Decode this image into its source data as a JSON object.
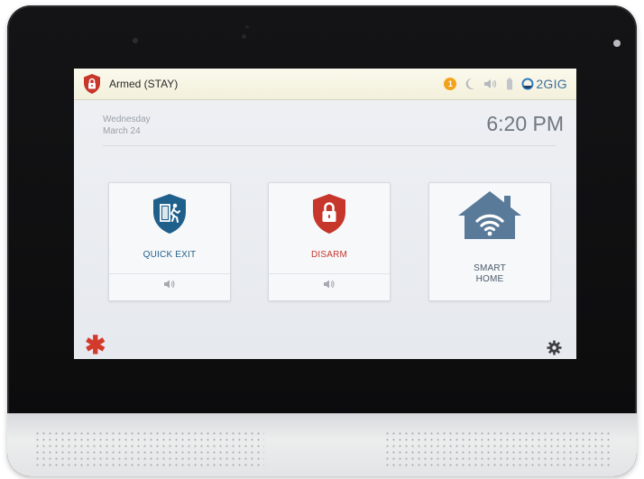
{
  "status_bar": {
    "arm_status": "Armed (STAY)",
    "alert_count": "1",
    "brand": "2GIG"
  },
  "datetime": {
    "weekday": "Wednesday",
    "date": "March 24",
    "time": "6:20 PM"
  },
  "tiles": [
    {
      "label": "QUICK EXIT",
      "icon": "quick-exit-shield-icon",
      "color": "#1f5f8b"
    },
    {
      "label": "DISARM",
      "icon": "lock-shield-icon",
      "color": "#c6362a"
    },
    {
      "label_line1": "SMART",
      "label_line2": "HOME",
      "icon": "smart-home-icon",
      "color": "#5a7a99"
    }
  ],
  "colors": {
    "armed_red": "#c6362a",
    "quick_exit_blue": "#1f5f8b",
    "smart_home_slate": "#5a7a99",
    "alert_orange": "#f3a31b",
    "asterisk_red": "#d33a2c"
  },
  "icons": {
    "status": [
      "alert-badge-icon",
      "moon-icon",
      "speaker-icon",
      "battery-icon",
      "brand-logo-icon"
    ],
    "bottom_left": "asterisk-icon",
    "bottom_right": "gear-icon",
    "tile_footer": "chime-speaker-icon"
  }
}
